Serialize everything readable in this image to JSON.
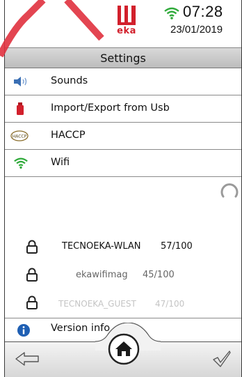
{
  "header": {
    "brand": "eka",
    "time": "07:28",
    "date": "23/01/2019",
    "wifi_icon": "wifi-icon"
  },
  "title": "Settings",
  "menu": [
    {
      "label": "Sounds",
      "icon": "speaker-icon"
    },
    {
      "label": "Import/Export from Usb",
      "icon": "usb-icon"
    },
    {
      "label": "HACCP",
      "icon": "haccp-icon",
      "icon_text": "HACCP"
    },
    {
      "label": "Wifi",
      "icon": "wifi-icon"
    }
  ],
  "networks": [
    {
      "ssid": "TECNOEKA-WLAN",
      "signal": "57/100",
      "color": "#111111"
    },
    {
      "ssid": "ekawifimag",
      "signal": "45/100",
      "color": "#666666"
    },
    {
      "ssid": "TECNOEKA_GUEST",
      "signal": "47/100",
      "color": "#c4c4c4"
    }
  ],
  "version": {
    "label": "Version info",
    "icon": "info-icon"
  },
  "footer": {
    "back_icon": "back-arrow-icon",
    "home_icon": "home-icon",
    "ok_icon": "checkmark-icon"
  },
  "colors": {
    "brand_red": "#d2202c",
    "wifi_green": "#2faa3a",
    "info_blue": "#1f5fb3"
  }
}
